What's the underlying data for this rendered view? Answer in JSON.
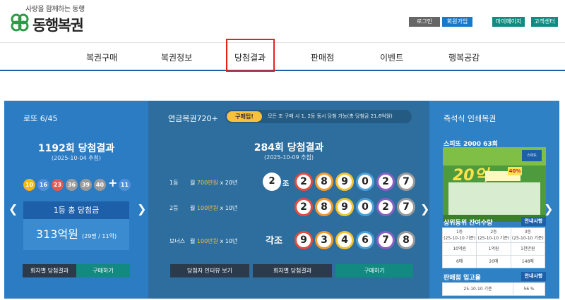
{
  "header": {
    "tagline": "사랑을 함께하는 동행",
    "brand": "동행복권",
    "buttons": {
      "login": "로그인",
      "join": "회원가입",
      "mypage": "마이페이지",
      "cs": "고객센터"
    },
    "colors": {
      "nav_line": "#1d5fa8",
      "highlight": "#e8211b"
    }
  },
  "nav": {
    "items": [
      "복권구매",
      "복권정보",
      "당첨결과",
      "판매점",
      "이벤트",
      "행복공감"
    ],
    "highlighted": "당첨결과"
  },
  "lotto": {
    "title": "로또 6/45",
    "round": "1192회 당첨결과",
    "date": "(2025-10-04 추첨)",
    "numbers": [
      {
        "n": "10",
        "color": "#f5b80c"
      },
      {
        "n": "16",
        "color": "#4f8fd9"
      },
      {
        "n": "23",
        "color": "#e35a4c"
      },
      {
        "n": "36",
        "color": "#9a9a9a"
      },
      {
        "n": "39",
        "color": "#9a9a9a"
      },
      {
        "n": "40",
        "color": "#9a9a9a"
      }
    ],
    "plus": "+",
    "bonus": {
      "n": "11",
      "color": "#4f8fd9"
    },
    "prize_label": "1등 총 당첨금",
    "prize_amount": "313억원",
    "prize_detail": "(29명 / 11억)",
    "btn_history": "회차별 당첨결과",
    "btn_buy": "구매하기"
  },
  "pension": {
    "title": "연금복권720+",
    "tip_label": "구매팁!",
    "tip_text": "모든 조 구매 시 1, 2등 동시 당첨 가능(총 당첨금 21.6억원)",
    "round": "284회 당첨결과",
    "date": "(2025-10-09 추첨)",
    "rows": [
      {
        "rank": "1등",
        "prefix": "월 ",
        "amount": "700만원",
        "suffix": " x 20년",
        "group": "2",
        "group_label": "조",
        "digits": [
          "2",
          "8",
          "9",
          "0",
          "2",
          "7"
        ]
      },
      {
        "rank": "2등",
        "prefix": "월 ",
        "amount": "100만원",
        "suffix": " x 10년",
        "group": "",
        "group_label": "",
        "digits": [
          "2",
          "8",
          "9",
          "0",
          "2",
          "7"
        ]
      },
      {
        "rank": "보너스",
        "prefix": "월 ",
        "amount": "100만원",
        "suffix": " x 10년",
        "group": "각조",
        "group_label": "",
        "digits": [
          "9",
          "3",
          "4",
          "6",
          "7",
          "8"
        ]
      }
    ],
    "digit_colors": [
      "#e44b3c",
      "#f39a2b",
      "#f1c232",
      "#4a9fd8",
      "#8a5fc2",
      "#9a9a9a"
    ],
    "btn_interview": "당첨자 인터뷰 보기",
    "btn_history": "회차별 당첨결과",
    "btn_buy": "구매하기"
  },
  "instant": {
    "title": "즉석식 인쇄복권",
    "game": "스피또 2000 63회",
    "ticket_big": "20억",
    "ticket_pct": "40%",
    "ticket_badge": "스피또",
    "remain_title": "상위등위 잔여수량",
    "remain_btn": "안내사항",
    "remain_headers": [
      "1등\n(25-10-10 기준)",
      "2등\n(25-10-10 기준)",
      "3등\n(25-10-10 기준)"
    ],
    "remain_total": [
      "10억원",
      "1억원",
      "1천만원"
    ],
    "remain_count": [
      "6매",
      "20매",
      "148매"
    ],
    "stock_title": "판매점 입고율",
    "stock_btn": "안내사항",
    "stock_date": "25-10-10 기준",
    "stock_rate": "56 %"
  }
}
